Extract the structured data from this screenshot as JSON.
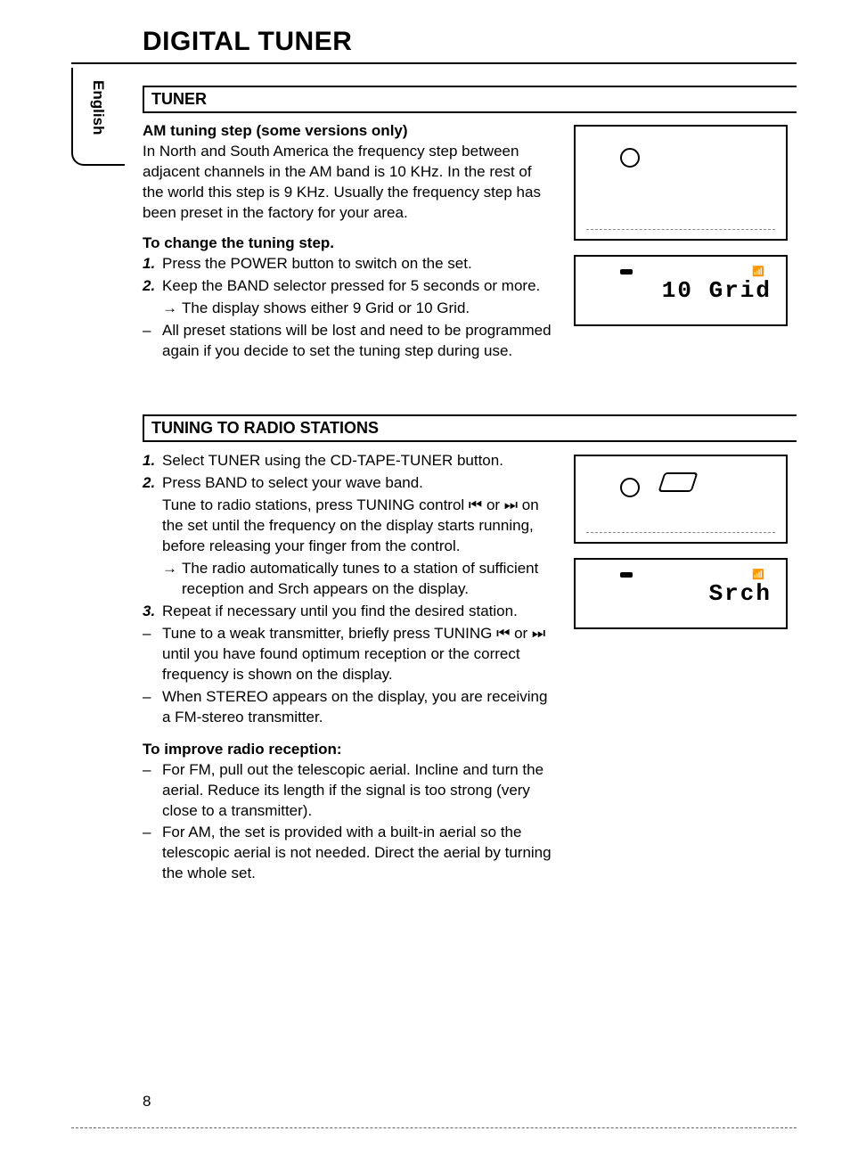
{
  "page": {
    "title": "DIGITAL TUNER",
    "language_tab": "English",
    "page_number": "8"
  },
  "section1": {
    "header": "TUNER",
    "sub1_title": "AM tuning step (some versions only)",
    "sub1_body": "In North and South America the frequency step between adjacent channels in the AM band is 10 KHz. In the rest of the world this step is 9 KHz. Usually the frequency step has been preset in the factory for your area.",
    "sub2_title": "To change the tuning step.",
    "step1": "Press the POWER button to switch on the set.",
    "step2": "Keep the BAND selector pressed for 5 seconds or more.",
    "step2_arrow": "The display shows either 9  Grid or 10  Grid.",
    "note1": "All preset stations will be lost and need to be programmed again if you decide to set the tuning step during use."
  },
  "section2": {
    "header": "TUNING TO RADIO STATIONS",
    "step1": "Select TUNER using the CD-TAPE-TUNER button.",
    "step2a": "Press BAND to select your wave band.",
    "step2b": "Tune to radio stations, press TUNING control ⏮ or ⏭ on the set until the frequency on the display starts running, before releasing your finger from the control.",
    "step2_arrow": "The radio automatically tunes to a station of sufficient reception and Srch appears on the display.",
    "step3": "Repeat if necessary until you find the desired station.",
    "note1": "Tune to a weak transmitter, briefly press TUNING ⏮ or ⏭ until you have found optimum reception or the correct frequency is shown on the display.",
    "note2": "When STEREO appears on the display, you are receiving a FM-stereo transmitter.",
    "sub3_title": "To improve radio reception:",
    "note3": "For FM, pull out the telescopic aerial. Incline and turn the aerial. Reduce its length if the signal is too strong (very close to a transmitter).",
    "note4": "For  AM, the set is provided with a built-in aerial so the telescopic aerial is not needed. Direct the aerial by turning the whole set."
  },
  "figures": {
    "display1": "10 Grid",
    "display2": "Srch"
  }
}
